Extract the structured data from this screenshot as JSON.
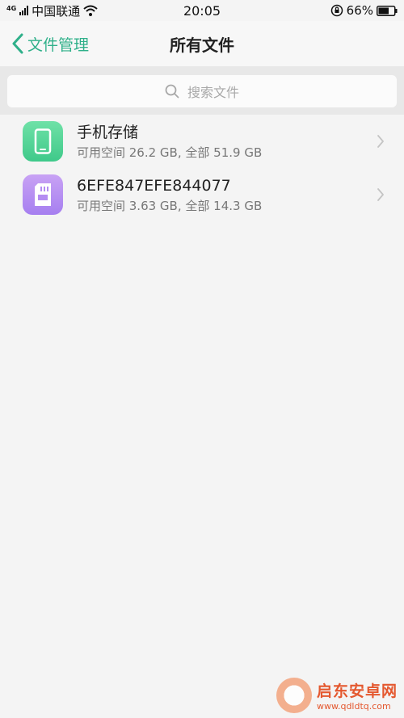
{
  "status_bar": {
    "network_type": "4G",
    "carrier": "中国联通",
    "time": "20:05",
    "battery": "66%"
  },
  "header": {
    "back_label": "文件管理",
    "title": "所有文件"
  },
  "search": {
    "placeholder": "搜索文件"
  },
  "storage_items": [
    {
      "title": "手机存储",
      "subtitle": "可用空间 26.2 GB, 全部 51.9 GB",
      "icon": "phone-icon"
    },
    {
      "title": "6EFE847EFE844077",
      "subtitle": "可用空间 3.63 GB, 全部 14.3 GB",
      "icon": "sd-card-icon"
    }
  ],
  "watermark": {
    "title": "启东安卓网",
    "url": "www.qdldtq.com"
  },
  "colors": {
    "accent": "#2fb08a",
    "phone_icon": "#4fd394",
    "sd_icon": "#b48cf2",
    "watermark": "#e4582f"
  }
}
